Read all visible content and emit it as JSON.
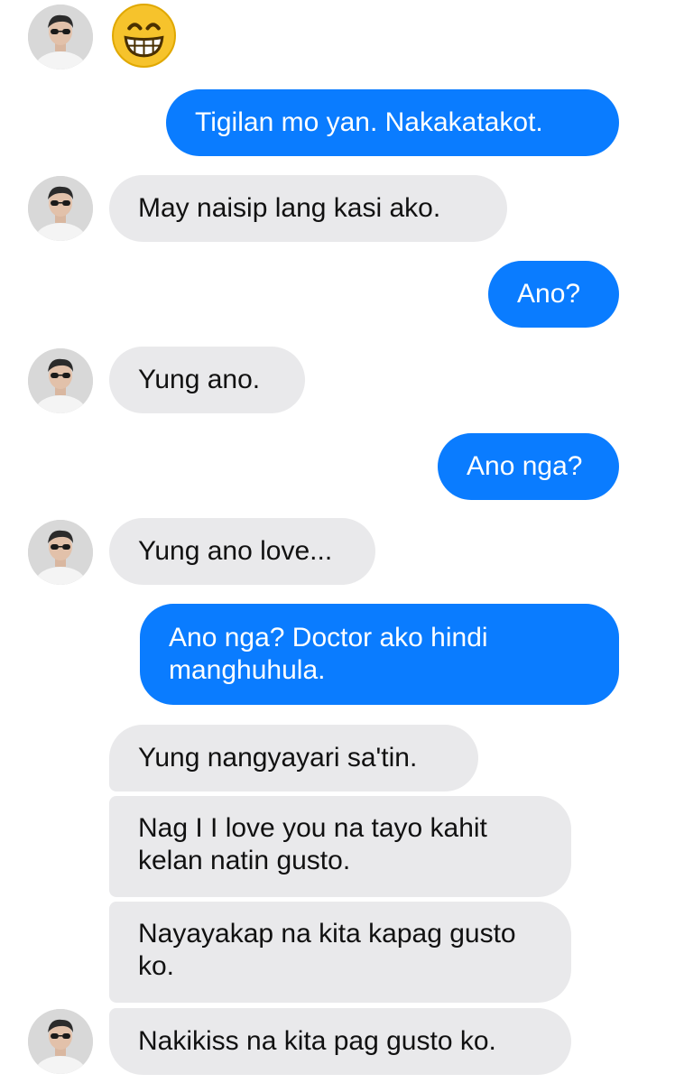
{
  "conversation": {
    "emoji_name": "grinning-face-with-smiling-eyes",
    "messages": [
      {
        "from": "them",
        "text": "Tigilan mo yan. Nakakatakot."
      },
      {
        "from": "me",
        "text": "Tigilan mo yan. Nakakatakot."
      }
    ],
    "m1": "Tigilan mo yan. Nakakatakot.",
    "m2": "May naisip lang kasi ako.",
    "m3": "Ano?",
    "m4": "Yung ano.",
    "m5": "Ano nga?",
    "m6": "Yung ano love...",
    "m7": "Ano nga? Doctor ako hindi manghuhula.",
    "m8": "Yung nangyayari sa'tin.",
    "m9": "Nag I I love you na tayo kahit kelan natin gusto.",
    "m10": "Nayayakap na kita kapag gusto ko.",
    "m11": "Nakikiss na kita pag gusto ko."
  },
  "colors": {
    "sent_bubble": "#0a7cff",
    "received_bubble": "#e9e9eb"
  }
}
